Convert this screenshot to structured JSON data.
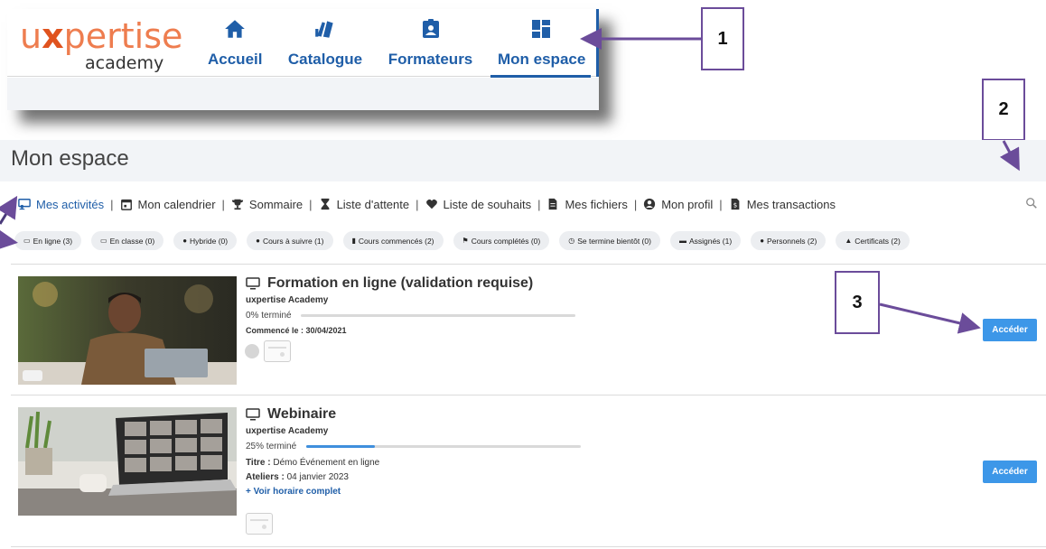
{
  "nav": {
    "logo_prefix": "u",
    "logo_x": "x",
    "logo_suffix": "pertise",
    "logo_sub": "academy",
    "items": [
      {
        "label": "Accueil",
        "icon": "home-icon"
      },
      {
        "label": "Catalogue",
        "icon": "books-icon"
      },
      {
        "label": "Formateurs",
        "icon": "trainer-badge-icon"
      },
      {
        "label": "Mon espace",
        "icon": "dashboard-icon",
        "active": true
      }
    ],
    "accent": "#1f5ea8"
  },
  "annotations": [
    "1",
    "2",
    "3"
  ],
  "page": {
    "title": "Mon espace"
  },
  "tabs": [
    {
      "label": "Mes activités",
      "icon": "activities-icon",
      "active": true
    },
    {
      "label": "Mon calendrier",
      "icon": "calendar-icon"
    },
    {
      "label": "Sommaire",
      "icon": "trophy-icon"
    },
    {
      "label": "Liste d'attente",
      "icon": "hourglass-icon"
    },
    {
      "label": "Liste de souhaits",
      "icon": "heart-icon"
    },
    {
      "label": "Mes fichiers",
      "icon": "file-icon"
    },
    {
      "label": "Mon profil",
      "icon": "user-circle-icon"
    },
    {
      "label": "Mes transactions",
      "icon": "receipt-icon"
    }
  ],
  "filters": [
    {
      "label": "En ligne (3)",
      "icon": "monitor-icon",
      "glyph": "▭"
    },
    {
      "label": "En classe (0)",
      "icon": "classroom-icon",
      "glyph": "▭"
    },
    {
      "label": "Hybride (0)",
      "icon": "check-circle-icon",
      "glyph": "●"
    },
    {
      "label": "Cours à suivre (1)",
      "icon": "plus-circle-icon",
      "glyph": "●"
    },
    {
      "label": "Cours commencés (2)",
      "icon": "bookmark-icon",
      "glyph": "▮"
    },
    {
      "label": "Cours complétés (0)",
      "icon": "flag-icon",
      "glyph": "⚑"
    },
    {
      "label": "Se termine bientôt (0)",
      "icon": "clock-icon",
      "glyph": "◷"
    },
    {
      "label": "Assignés (1)",
      "icon": "id-card-icon",
      "glyph": "▬"
    },
    {
      "label": "Personnels (2)",
      "icon": "person-icon",
      "glyph": "●"
    },
    {
      "label": "Certificats (2)",
      "icon": "graduation-cap-icon",
      "glyph": "▲"
    }
  ],
  "courses": [
    {
      "title": "Formation en ligne (validation requise)",
      "org": "uxpertise Academy",
      "progress_label": "0% terminé",
      "progress": 0,
      "started_label": "Commencé le : 30/04/2021",
      "button": "Accéder"
    },
    {
      "title": "Webinaire",
      "org": "uxpertise Academy",
      "progress_label": "25% terminé",
      "progress": 25,
      "title_label": "Titre :",
      "title_value": " Démo Événement en ligne",
      "workshops_label": "Ateliers :",
      "workshops_value": " 04 janvier 2023",
      "schedule_link": "+ Voir horaire complet",
      "button": "Accéder"
    }
  ]
}
